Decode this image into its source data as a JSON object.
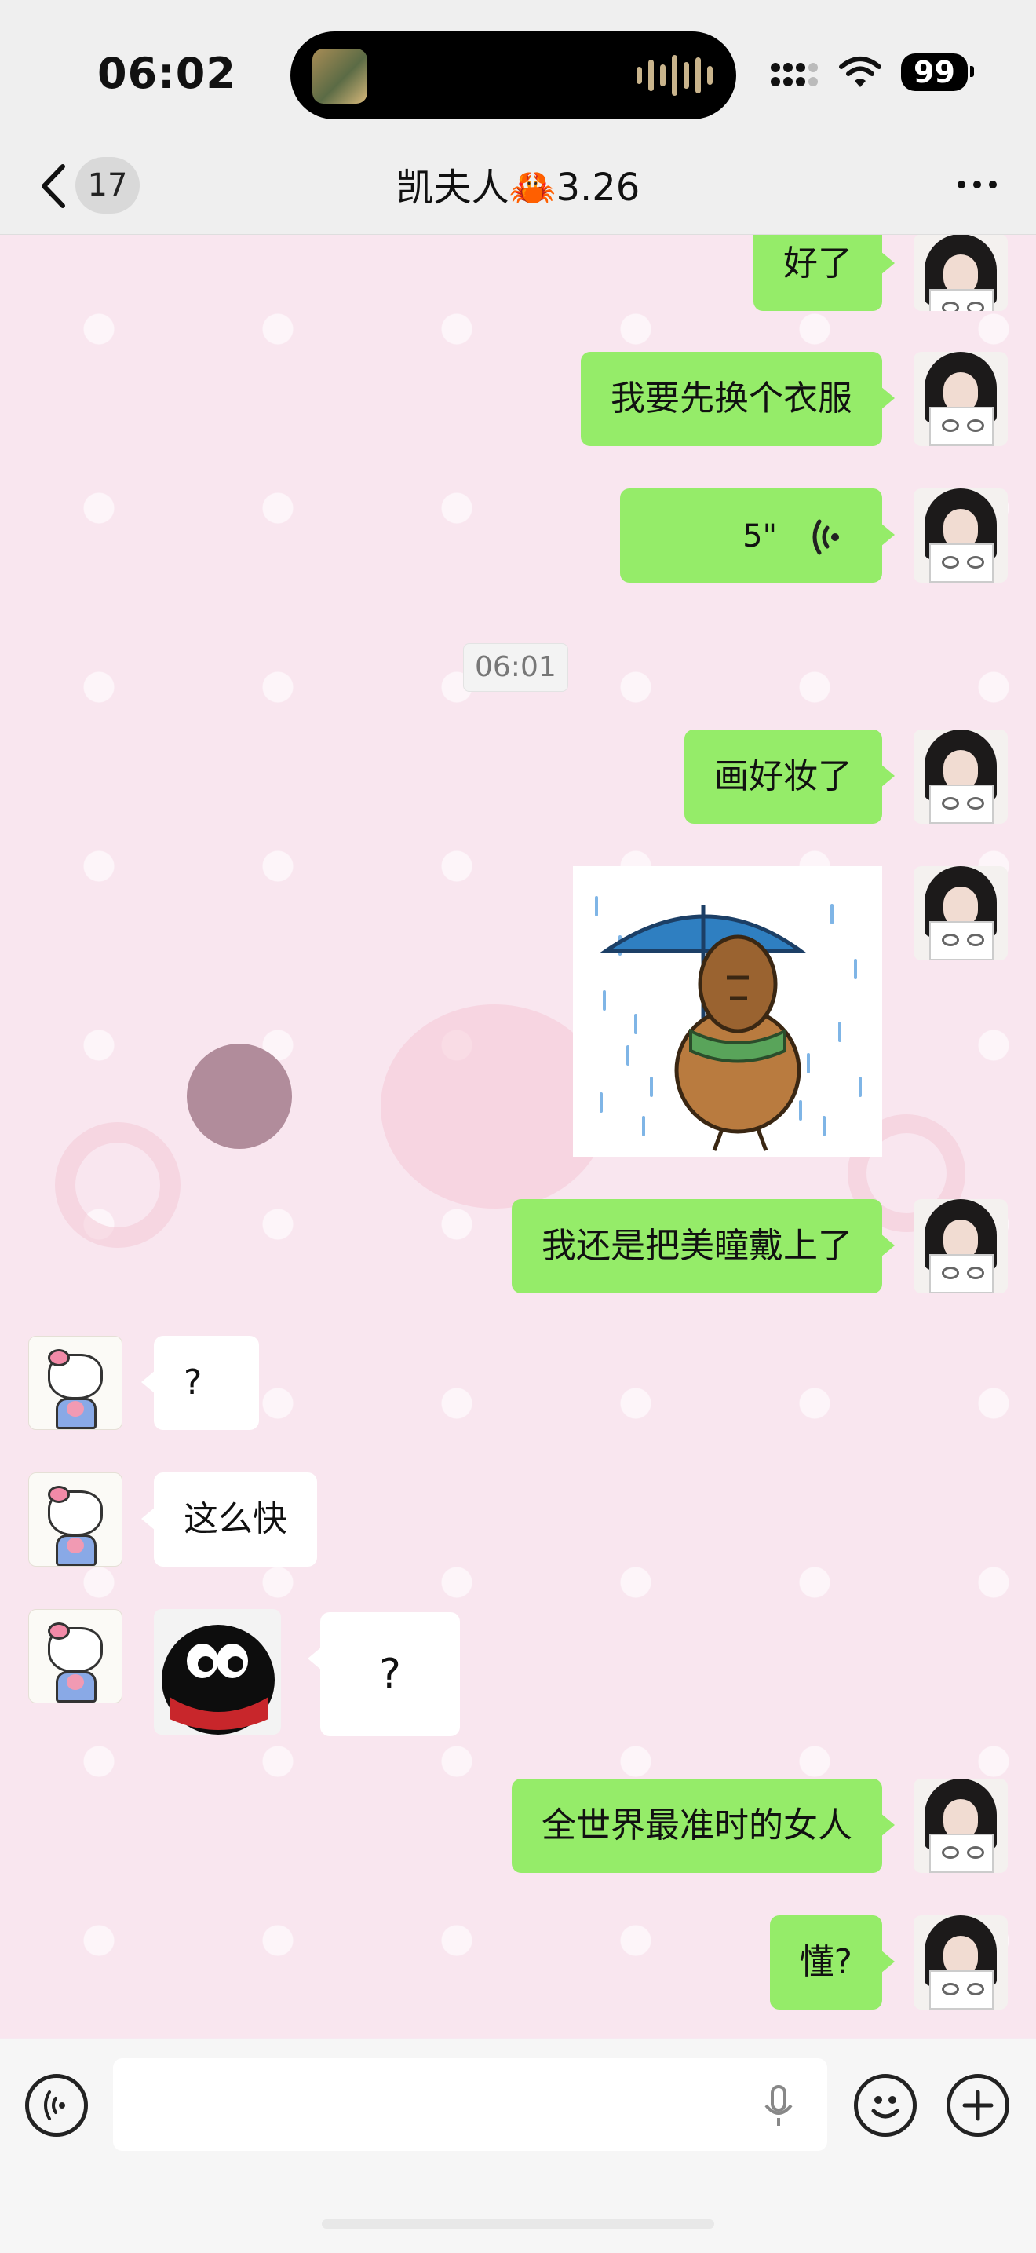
{
  "status_bar": {
    "time": "06:02",
    "battery": "99",
    "icons": [
      "signal-icon",
      "wifi-icon",
      "battery-icon"
    ]
  },
  "nav": {
    "unread_count": "17",
    "title": "凯夫人🦀3.26",
    "icons": [
      "back-chevron-icon",
      "more-icon"
    ]
  },
  "chat": {
    "timestamp": "06:01",
    "messages": [
      {
        "side": "out",
        "type": "text",
        "text": "好了"
      },
      {
        "side": "out",
        "type": "text",
        "text": "我要先换个衣服"
      },
      {
        "side": "out",
        "type": "voice",
        "text": "5\""
      },
      {
        "side": "out",
        "type": "text",
        "text": "画好妆了"
      },
      {
        "side": "out",
        "type": "sticker",
        "sticker": "bird-with-umbrella-sticker"
      },
      {
        "side": "out",
        "type": "text",
        "text": "我还是把美瞳戴上了"
      },
      {
        "side": "in",
        "type": "text",
        "text": "?"
      },
      {
        "side": "in",
        "type": "text",
        "text": "这么快"
      },
      {
        "side": "in",
        "type": "sticker",
        "sticker": "penguin-sticker"
      },
      {
        "side": "in",
        "type": "text",
        "text": "?"
      },
      {
        "side": "out",
        "type": "text",
        "text": "全世界最准时的女人"
      },
      {
        "side": "out",
        "type": "text",
        "text": "懂?"
      }
    ]
  },
  "input_bar": {
    "placeholder": "",
    "icons": [
      "voice-mode-icon",
      "microphone-icon",
      "emoji-icon",
      "plus-icon"
    ]
  },
  "colors": {
    "outgoing_bubble": "#95ec69",
    "incoming_bubble": "#ffffff",
    "chat_bg": "#f9e6ef",
    "bar_bg": "#efefef"
  }
}
